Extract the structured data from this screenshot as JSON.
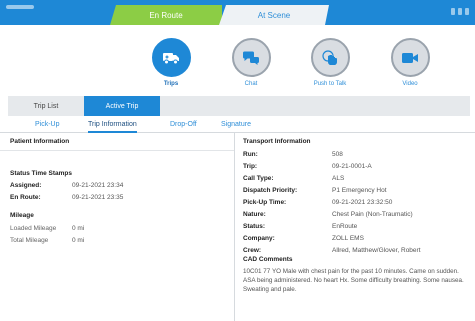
{
  "status_tabs": {
    "en_route": "En Route",
    "at_scene": "At Scene"
  },
  "colors": {
    "accent": "#1e88d6",
    "en_route": "#8ccd45",
    "at_scene_bg": "#eef2f5"
  },
  "actions": [
    {
      "label": "Trips",
      "icon": "ambulance-icon",
      "active": true
    },
    {
      "label": "Chat",
      "icon": "chat-bubbles-icon",
      "active": false
    },
    {
      "label": "Push to Talk",
      "icon": "push-to-talk-icon",
      "active": false
    },
    {
      "label": "Video",
      "icon": "video-camera-icon",
      "active": false
    }
  ],
  "trip_tabs": {
    "list": "Trip List",
    "active": "Active Trip"
  },
  "sub_tabs": {
    "pickup": "Pick-Up",
    "trip_info": "Trip Information",
    "dropoff": "Drop-Off",
    "signature": "Signature"
  },
  "patient": {
    "title": "Patient Information",
    "timestamps_title": "Status Time Stamps",
    "assigned_label": "Assigned:",
    "assigned_value": "09-21-2021 23:34",
    "enroute_label": "En Route:",
    "enroute_value": "09-21-2021 23:35",
    "mileage_title": "Mileage",
    "loaded_label": "Loaded Mileage",
    "loaded_value": "0 mi",
    "total_label": "Total Mileage",
    "total_value": "0 mi"
  },
  "transport": {
    "title": "Transport Information",
    "rows": [
      {
        "label": "Run:",
        "value": "508"
      },
      {
        "label": "Trip:",
        "value": "09-21-0001-A"
      },
      {
        "label": "Call Type:",
        "value": "ALS"
      },
      {
        "label": "Dispatch Priority:",
        "value": "P1 Emergency Hot"
      },
      {
        "label": "Pick-Up Time:",
        "value": "09-21-2021 23:32:50"
      },
      {
        "label": "Nature:",
        "value": "Chest Pain (Non-Traumatic)"
      },
      {
        "label": "Status:",
        "value": "EnRoute"
      },
      {
        "label": "Company:",
        "value": "ZOLL EMS"
      },
      {
        "label": "Crew:",
        "value": "Allred, Matthew/Glover, Robert"
      }
    ],
    "cad_title": "CAD Comments",
    "cad_text": "10C01 77 YO Male with chest pain for the past 10 minutes. Came on sudden. ASA being administered. No heart Hx. Some difficulty breathing. Some nausea. Sweating and pale."
  }
}
